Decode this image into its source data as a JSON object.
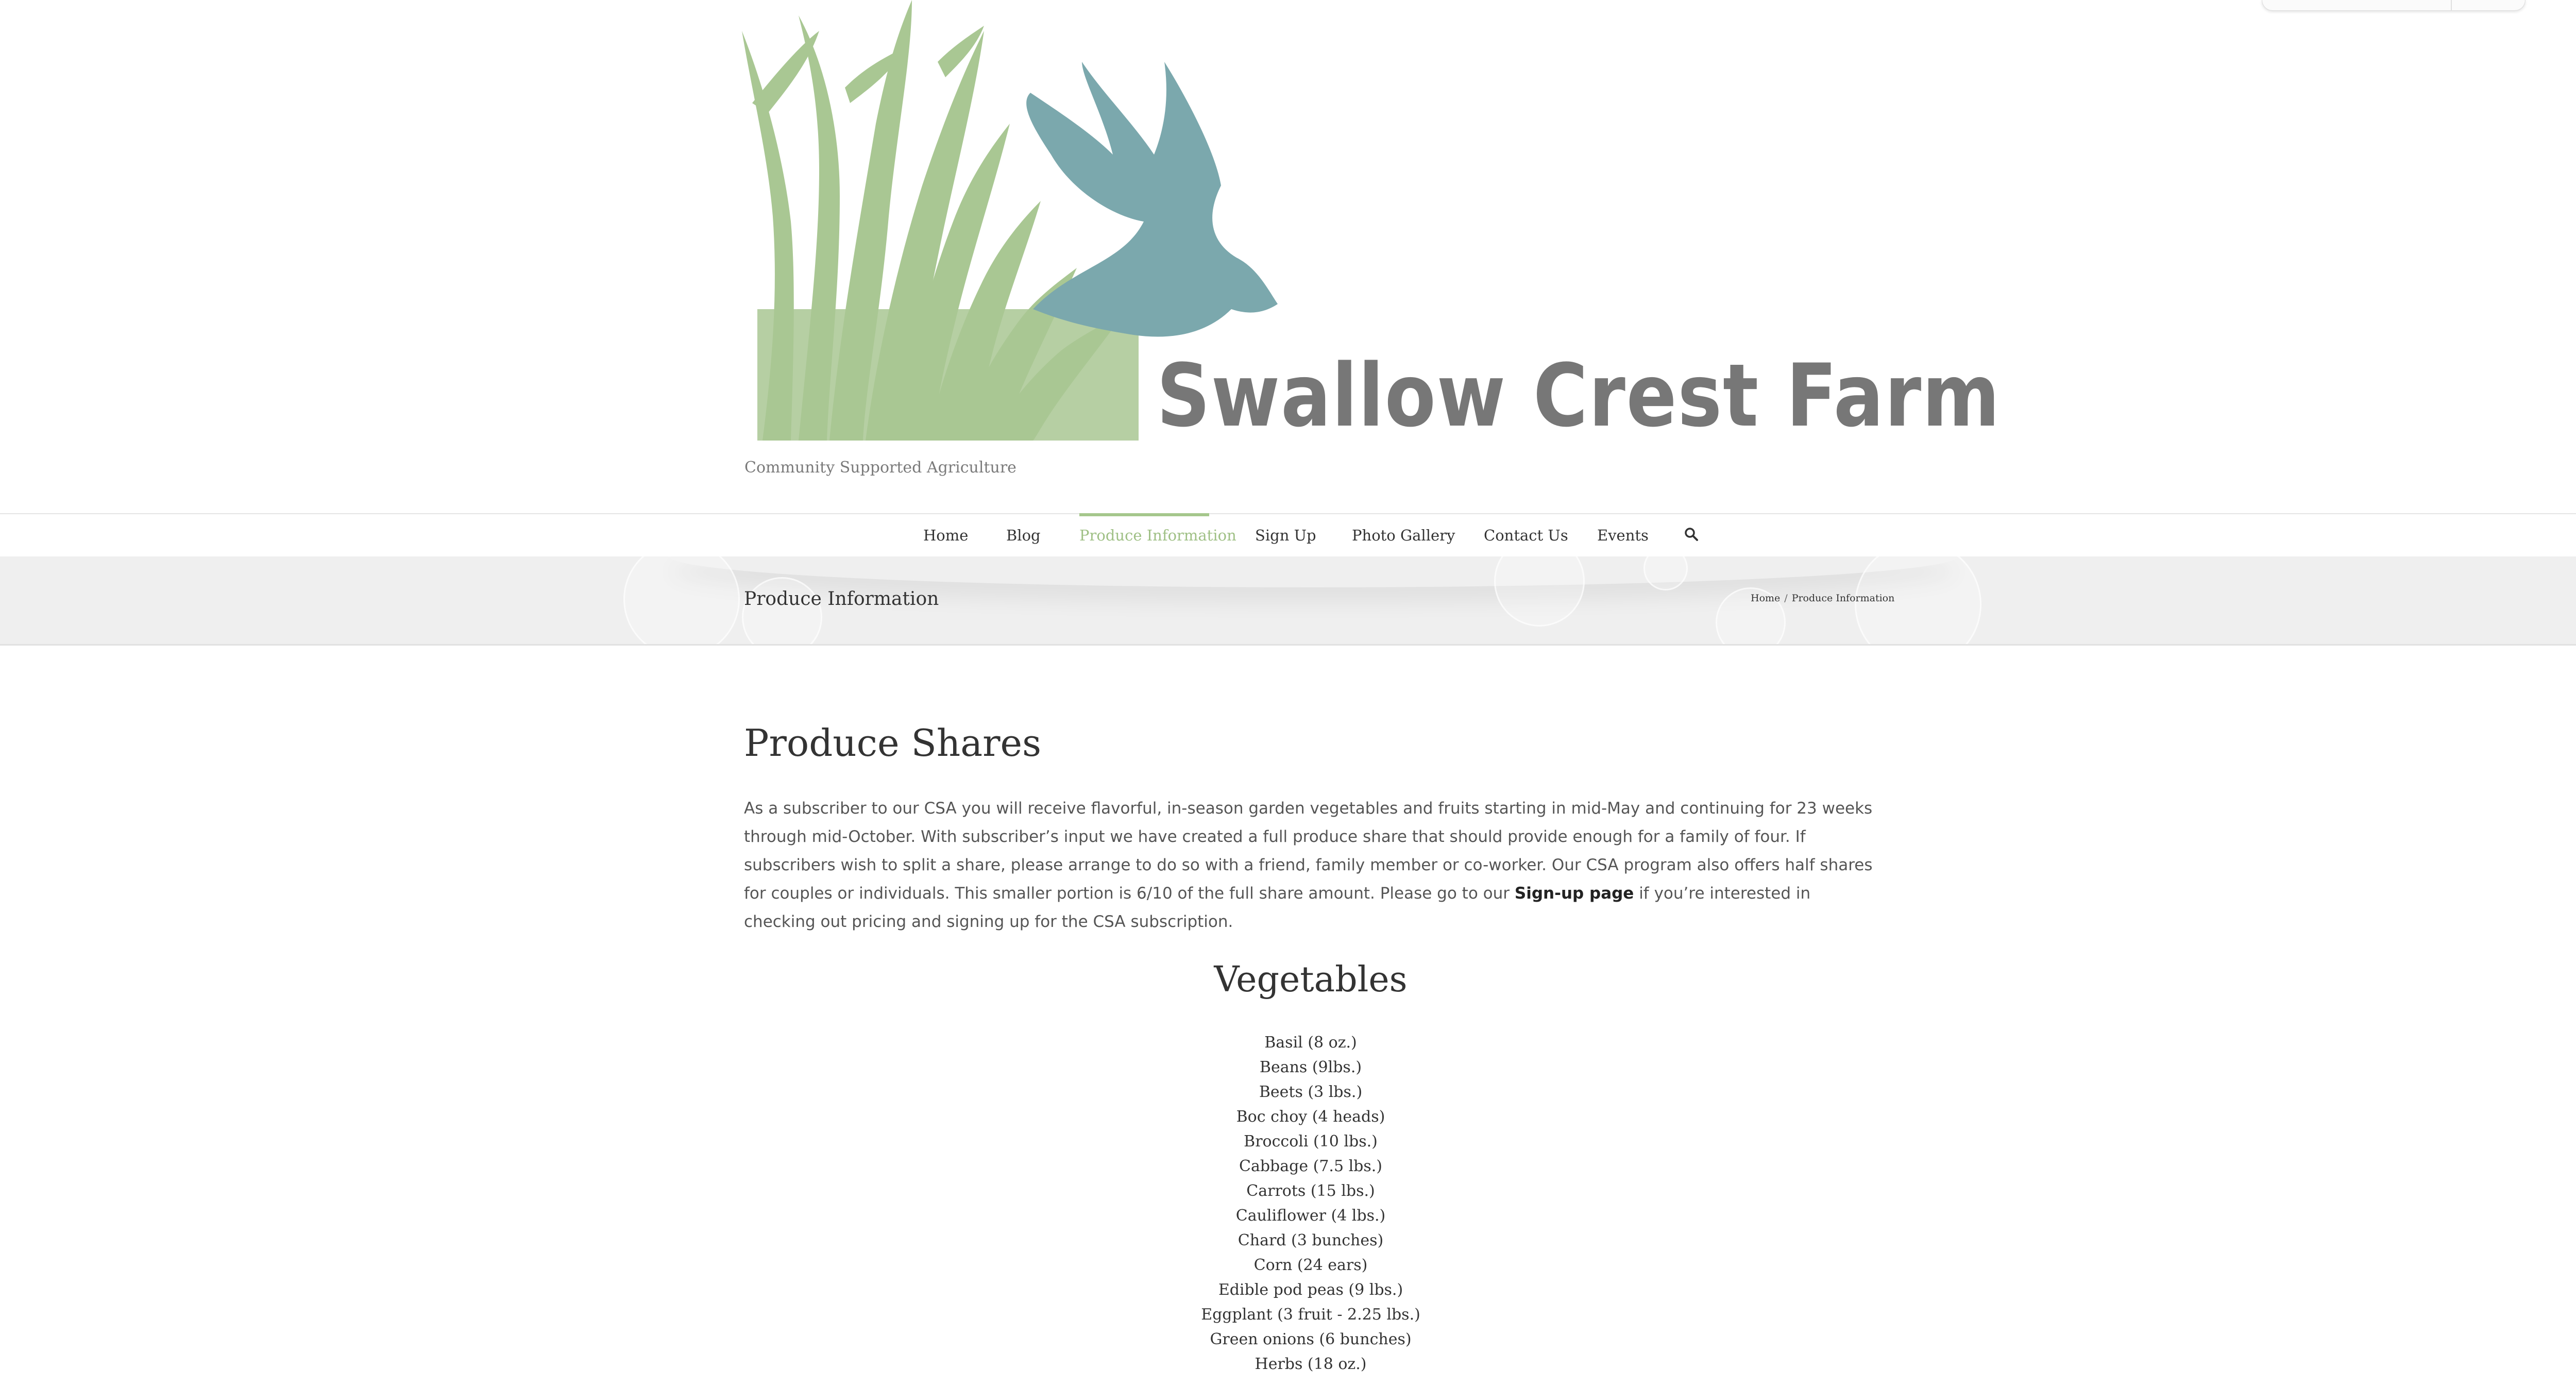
{
  "header": {
    "site_name": "Swallow Crest Farm",
    "tagline": "Community Supported Agriculture"
  },
  "nav": {
    "items": [
      {
        "label": "Home",
        "active": false
      },
      {
        "label": "Blog",
        "active": false
      },
      {
        "label": "Produce Information",
        "active": true
      },
      {
        "label": "Sign Up",
        "active": false
      },
      {
        "label": "Photo Gallery",
        "active": false
      },
      {
        "label": "Contact Us",
        "active": false
      },
      {
        "label": "Events",
        "active": false
      }
    ],
    "search_icon": "search-icon",
    "active_color": "#9fc085"
  },
  "title_bar": {
    "title": "Produce Information",
    "breadcrumb": {
      "home": "Home",
      "separator": "/",
      "current": "Produce Information"
    }
  },
  "content": {
    "heading": "Produce Shares",
    "intro_before_link": "As a subscriber to our CSA you will receive flavorful, in-season garden vegetables and fruits starting in mid-May and continuing for 23 weeks through mid-October. With subscriber’s input we have created a full produce share that should provide enough for a family of four. If subscribers wish to split a share, please arrange to do so with a friend, family member or co-worker. Our CSA program also offers half shares for couples or individuals. This smaller portion is 6/10 of the full share amount. Please go to our ",
    "intro_link": "Sign-up page",
    "intro_after_link": " if you’re interested in checking out pricing and signing up for the CSA subscription.",
    "vegetables_heading": "Vegetables",
    "vegetables": [
      "Basil (8 oz.)",
      "Beans (9lbs.)",
      "Beets (3 lbs.)",
      "Boc choy (4 heads)",
      "Broccoli (10 lbs.)",
      "Cabbage (7.5 lbs.)",
      "Carrots (15 lbs.)",
      "Cauliflower (4 lbs.)",
      "Chard (3 bunches)",
      "Corn (24 ears)",
      "Edible pod peas (9 lbs.)",
      "Eggplant (3 fruit - 2.25 lbs.)",
      "Green onions (6 bunches)",
      "Herbs (18 oz.)"
    ]
  },
  "colors": {
    "logo_grass": "#a9c793",
    "logo_bird": "#7ba8ad",
    "logo_text": "#777777"
  }
}
